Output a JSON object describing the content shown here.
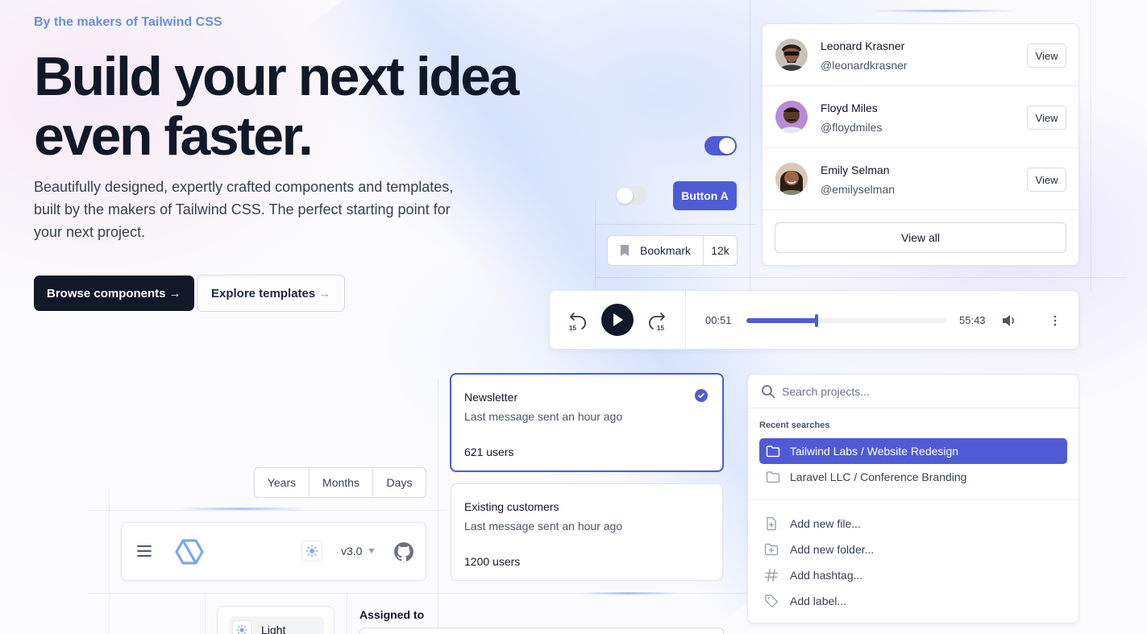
{
  "hero": {
    "eyebrow": "By the makers of Tailwind CSS",
    "headline_line1": "Build your next idea",
    "headline_line2": "even faster.",
    "subtitle": "Beautifully designed, expertly crafted components and templates, built by the makers of Tailwind CSS. The perfect starting point for your next project.",
    "primary_button": "Browse components",
    "secondary_button": "Explore templates",
    "arrow": "→"
  },
  "controls": {
    "toggle_on": true,
    "toggle_off": false,
    "button_a": "Button A",
    "bookmark_label": "Bookmark",
    "bookmark_count": "12k"
  },
  "people": {
    "items": [
      {
        "name": "Leonard Krasner",
        "handle": "@leonardkrasner",
        "action": "View"
      },
      {
        "name": "Floyd Miles",
        "handle": "@floydmiles",
        "action": "View"
      },
      {
        "name": "Emily Selman",
        "handle": "@emilyselman",
        "action": "View"
      }
    ],
    "view_all": "View all"
  },
  "player": {
    "current_time": "00:51",
    "total_time": "55:43",
    "skip_back": "15",
    "skip_forward": "15",
    "progress": 0.35
  },
  "mailing_lists": [
    {
      "title": "Newsletter",
      "description": "Last message sent an hour ago",
      "users": "621 users",
      "selected": true
    },
    {
      "title": "Existing customers",
      "description": "Last message sent an hour ago",
      "users": "1200 users",
      "selected": false
    }
  ],
  "segmented": {
    "options": [
      "Years",
      "Months",
      "Days"
    ]
  },
  "navbar": {
    "version": "v3.0",
    "icons": [
      "menu-icon",
      "logo-hexagon-icon",
      "sun-icon",
      "chevron-down-icon",
      "github-icon"
    ]
  },
  "theme_menu": {
    "light_label": "Light"
  },
  "form": {
    "assigned_label": "Assigned to"
  },
  "palette": {
    "placeholder": "Search projects...",
    "recent_heading": "Recent searches",
    "recent": [
      {
        "label": "Tailwind Labs / Website Redesign",
        "active": true
      },
      {
        "label": "Laravel LLC / Conference Branding",
        "active": false
      }
    ],
    "actions": [
      {
        "label": "Add new file...",
        "icon": "file-plus-icon"
      },
      {
        "label": "Add new folder...",
        "icon": "folder-plus-icon"
      },
      {
        "label": "Add hashtag...",
        "icon": "hashtag-icon"
      },
      {
        "label": "Add label...",
        "icon": "tag-icon"
      }
    ]
  },
  "colors": {
    "accent": "#4f5bd5",
    "dark": "#111827",
    "eyebrow": "#6b8fd6"
  }
}
